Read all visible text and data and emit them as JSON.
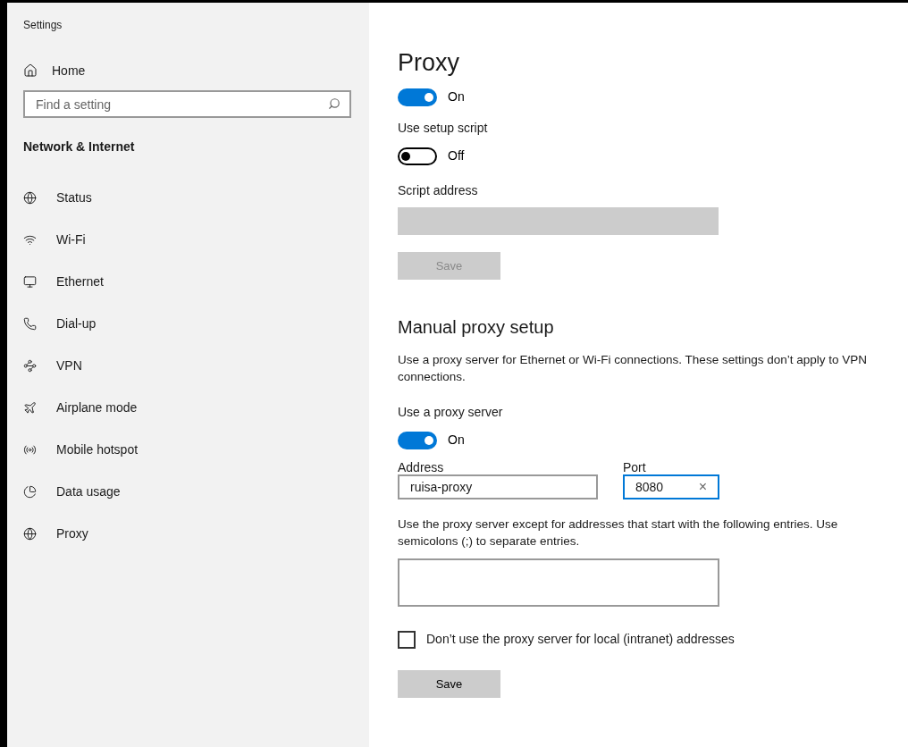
{
  "window": {
    "title": "Settings"
  },
  "sidebar": {
    "home": "Home",
    "search": {
      "placeholder": "Find a setting"
    },
    "section": "Network & Internet",
    "items": [
      {
        "label": "Status"
      },
      {
        "label": "Wi-Fi"
      },
      {
        "label": "Ethernet"
      },
      {
        "label": "Dial-up"
      },
      {
        "label": "VPN"
      },
      {
        "label": "Airplane mode"
      },
      {
        "label": "Mobile hotspot"
      },
      {
        "label": "Data usage"
      },
      {
        "label": "Proxy"
      }
    ]
  },
  "content": {
    "title": "Proxy",
    "auto_detect": {
      "on": true,
      "state_label": "On"
    },
    "setup_script": {
      "label": "Use setup script",
      "on": false,
      "state_label": "Off"
    },
    "script_address": {
      "label": "Script address",
      "disabled": true
    },
    "save_1": {
      "label": "Save",
      "disabled": true
    },
    "manual": {
      "heading": "Manual proxy setup",
      "description": "Use a proxy server for Ethernet or Wi-Fi connections. These settings don’t apply to VPN connections.",
      "use_proxy": {
        "label": "Use a proxy server",
        "on": true,
        "state_label": "On"
      },
      "address": {
        "label": "Address",
        "value": "ruisa-proxy",
        "focused": false
      },
      "port": {
        "label": "Port",
        "value": "8080",
        "focused": true,
        "clear": "×"
      },
      "exceptions": {
        "description": "Use the proxy server except for addresses that start with the following entries. Use semicolons (;) to separate entries."
      },
      "local": {
        "label": "Don’t use the proxy server for local (intranet) addresses",
        "checked": false
      },
      "save_2": {
        "label": "Save",
        "disabled": false
      }
    }
  }
}
